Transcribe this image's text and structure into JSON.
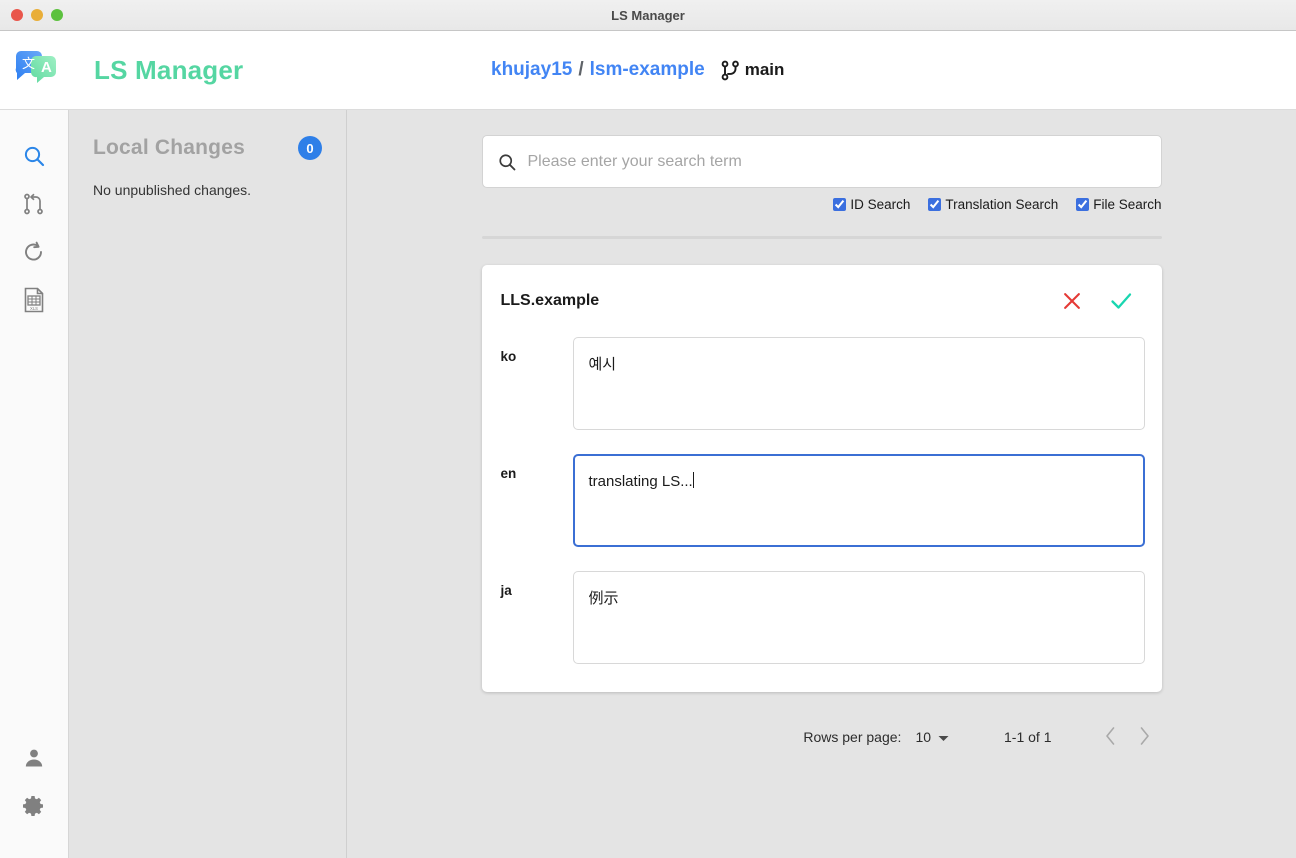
{
  "window": {
    "title": "LS Manager",
    "traffic_lights": [
      "close-red",
      "minimize-yellow",
      "maximize-green"
    ]
  },
  "header": {
    "logo_icon": "translate-icon",
    "app_title": "LS Manager",
    "breadcrumb": {
      "owner": "khujay15",
      "separator": "/",
      "repo": "lsm-example",
      "branch_icon": "git-branch-icon",
      "branch": "main"
    },
    "colors": {
      "app_title": "#55d6a2",
      "link": "#4285f4"
    }
  },
  "rail": {
    "items": [
      {
        "icon": "search-icon",
        "active": true,
        "color": "#2b86e8"
      },
      {
        "icon": "pull-request-icon",
        "active": false,
        "color": "#808080"
      },
      {
        "icon": "refresh-icon",
        "active": false,
        "color": "#808080"
      },
      {
        "icon": "xls-file-icon",
        "active": false,
        "color": "#808080"
      }
    ],
    "bottom_items": [
      {
        "icon": "person-icon",
        "color": "#808080"
      },
      {
        "icon": "gear-icon",
        "color": "#808080"
      }
    ]
  },
  "local_changes": {
    "title": "Local Changes",
    "count": "0",
    "empty_message": "No unpublished changes."
  },
  "search": {
    "icon": "search-icon",
    "value": "",
    "placeholder": "Please enter your search term",
    "filters": [
      {
        "label": "ID Search",
        "checked": true
      },
      {
        "label": "Translation Search",
        "checked": true
      },
      {
        "label": "File Search",
        "checked": true
      }
    ]
  },
  "result_card": {
    "id": "LLS.example",
    "actions": [
      {
        "name": "cancel-icon",
        "glyph": "✕",
        "color": "#e53935"
      },
      {
        "name": "confirm-icon",
        "glyph": "✓",
        "color": "#19d6b0"
      }
    ],
    "fields": [
      {
        "lang": "ko",
        "value": "예시",
        "focused": false
      },
      {
        "lang": "en",
        "value": "translating LS...",
        "focused": true
      },
      {
        "lang": "ja",
        "value": "例示",
        "focused": false
      }
    ]
  },
  "pagination": {
    "rows_per_page_label": "Rows per page:",
    "rows_per_page_value": "10",
    "dropdown_icon": "chevron-down-icon",
    "range": "1-1 of 1",
    "prev_icon": "chevron-left-icon",
    "next_icon": "chevron-right-icon"
  }
}
